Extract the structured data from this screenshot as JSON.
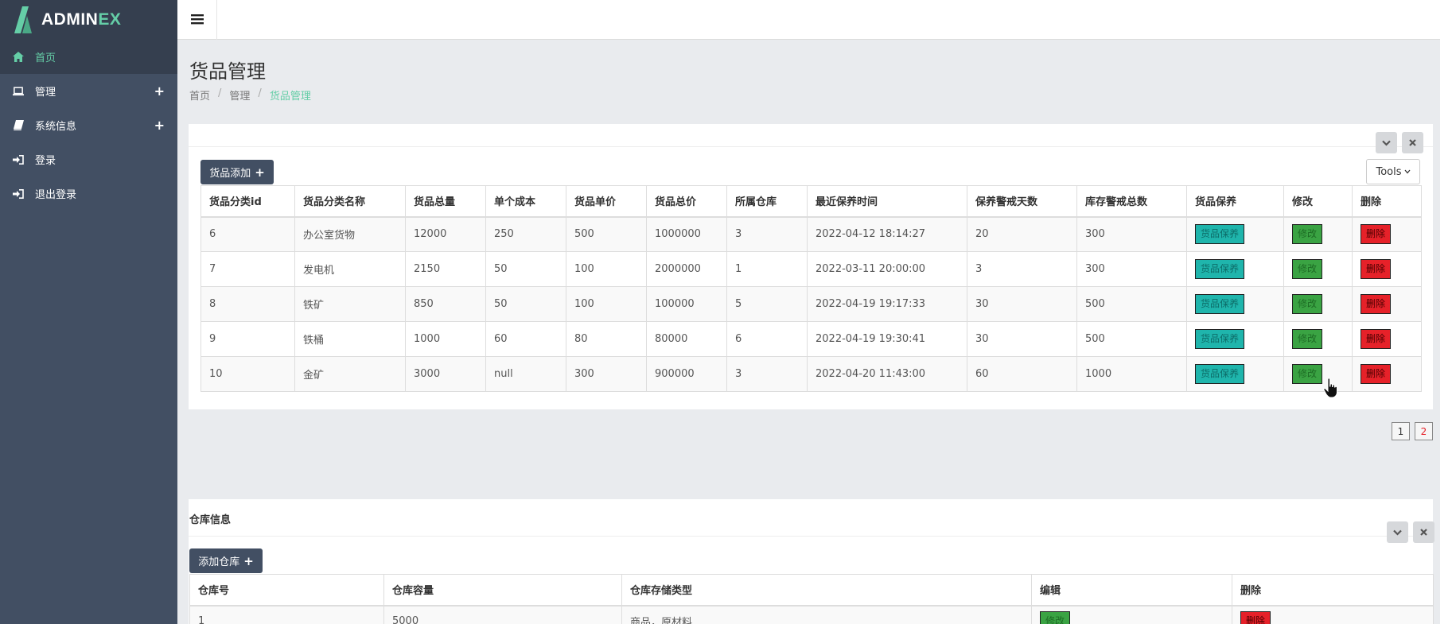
{
  "brand": {
    "name_part1": "ADMIN",
    "name_part2": "EX"
  },
  "sidebar": {
    "items": [
      {
        "label": "首页",
        "icon": "home-icon",
        "active": true
      },
      {
        "label": "管理",
        "icon": "laptop-icon",
        "expandable": true
      },
      {
        "label": "系统信息",
        "icon": "book-icon",
        "expandable": true
      },
      {
        "label": "登录",
        "icon": "sign-in-icon"
      },
      {
        "label": "退出登录",
        "icon": "sign-in-icon"
      }
    ]
  },
  "page": {
    "title": "货品管理",
    "breadcrumb": [
      "首页",
      "管理",
      "货品管理"
    ]
  },
  "goods_panel": {
    "add_button": "货品添加",
    "tools_button": "Tools",
    "columns": [
      "货品分类id",
      "货品分类名称",
      "货品总量",
      "单个成本",
      "货品单价",
      "货品总价",
      "所属仓库",
      "最近保养时间",
      "保养警戒天数",
      "库存警戒总数",
      "货品保养",
      "修改",
      "删除"
    ],
    "rows": [
      [
        "6",
        "办公室货物",
        "12000",
        "250",
        "500",
        "1000000",
        "3",
        "2022-04-12 18:14:27",
        "20",
        "300"
      ],
      [
        "7",
        "发电机",
        "2150",
        "50",
        "100",
        "2000000",
        "1",
        "2022-03-11 20:00:00",
        "3",
        "300"
      ],
      [
        "8",
        "铁矿",
        "850",
        "50",
        "100",
        "100000",
        "5",
        "2022-04-19 19:17:33",
        "30",
        "500"
      ],
      [
        "9",
        "铁桶",
        "1000",
        "60",
        "80",
        "80000",
        "6",
        "2022-04-19 19:30:41",
        "30",
        "500"
      ],
      [
        "10",
        "金矿",
        "3000",
        "null",
        "300",
        "900000",
        "3",
        "2022-04-20 11:43:00",
        "60",
        "1000"
      ]
    ],
    "maint_label": "货品保养",
    "edit_label": "修改",
    "delete_label": "删除",
    "pages": [
      "1",
      "2"
    ]
  },
  "warehouse_panel": {
    "title": "仓库信息",
    "add_button": "添加仓库",
    "columns": [
      "仓库号",
      "仓库容量",
      "仓库存储类型",
      "编辑",
      "删除"
    ],
    "rows": [
      [
        "1",
        "5000",
        "商品，原材料"
      ]
    ],
    "edit_label": "修改",
    "delete_label": "删除"
  },
  "colors": {
    "sidebar": "#424f63",
    "sidebar_dark": "#353f4f",
    "accent": "#65cea7",
    "maint": "#1fb5ac",
    "edit": "#3aa343",
    "delete": "#e62129"
  }
}
